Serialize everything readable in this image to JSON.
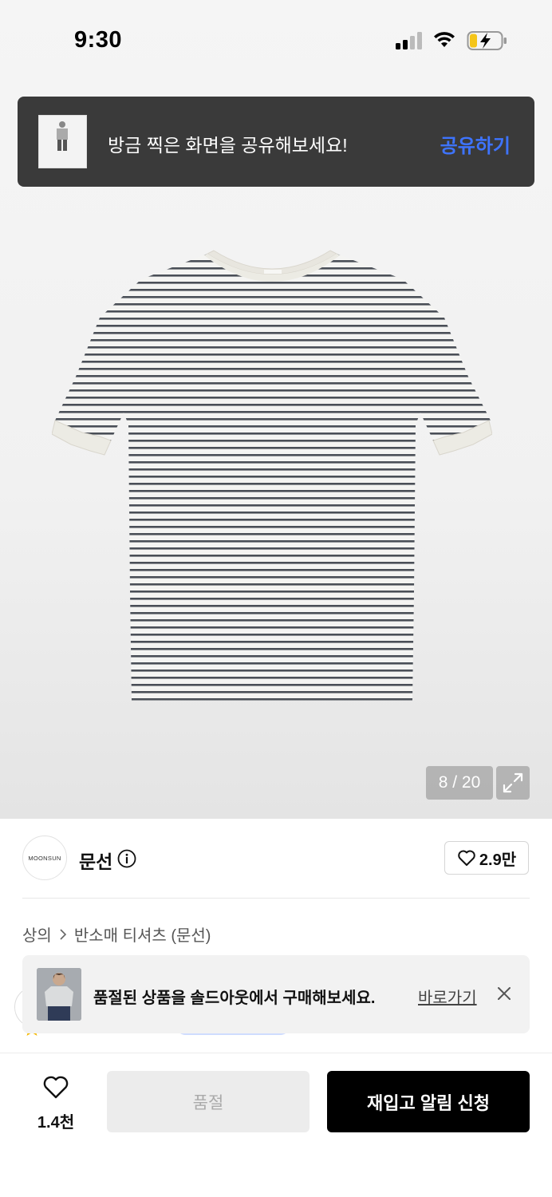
{
  "status_bar": {
    "time": "9:30"
  },
  "share_toast": {
    "message": "방금 찍은 화면을 공유해보세요!",
    "action": "공유하기"
  },
  "gallery": {
    "pager": "8 / 20"
  },
  "brand": {
    "logo_text": "MOONSUN",
    "name": "문선",
    "like_count": "2.9만"
  },
  "breadcrumb": {
    "category": "상의",
    "subcategory": "반소매 티셔츠 (문선)"
  },
  "soldout_banner": {
    "message": "품절된 상품을 솔드아웃에서 구매해보세요.",
    "link": "바로가기"
  },
  "bottom_bar": {
    "wish_count": "1.4천",
    "soldout_label": "품절",
    "restock_label": "재입고 알림 신청"
  },
  "colors": {
    "accent_blue": "#3e74ff",
    "toast_bg": "#3a3a3a",
    "primary_btn": "#000000"
  }
}
